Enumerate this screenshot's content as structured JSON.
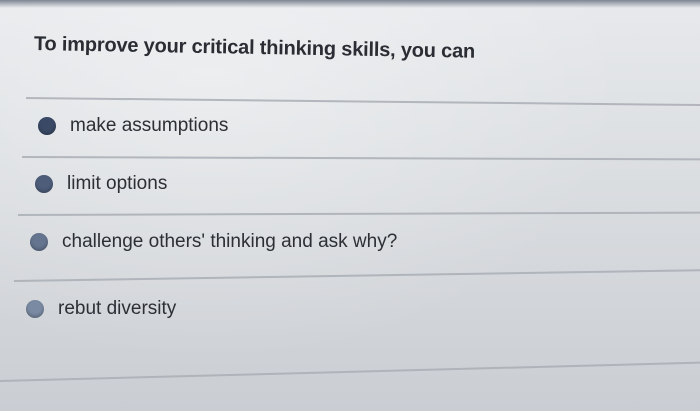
{
  "question": {
    "text": "To improve your critical thinking skills, you can"
  },
  "options": [
    {
      "label": "make assumptions"
    },
    {
      "label": "limit options"
    },
    {
      "label": "challenge others' thinking and ask why?"
    },
    {
      "label": "rebut diversity"
    }
  ],
  "colors": {
    "radio_fill_dark": "#3a4a66",
    "radio_fill_mid": "#5a6a85",
    "radio_fill_light": "#7a8aa2",
    "text": "#2c2f35"
  }
}
